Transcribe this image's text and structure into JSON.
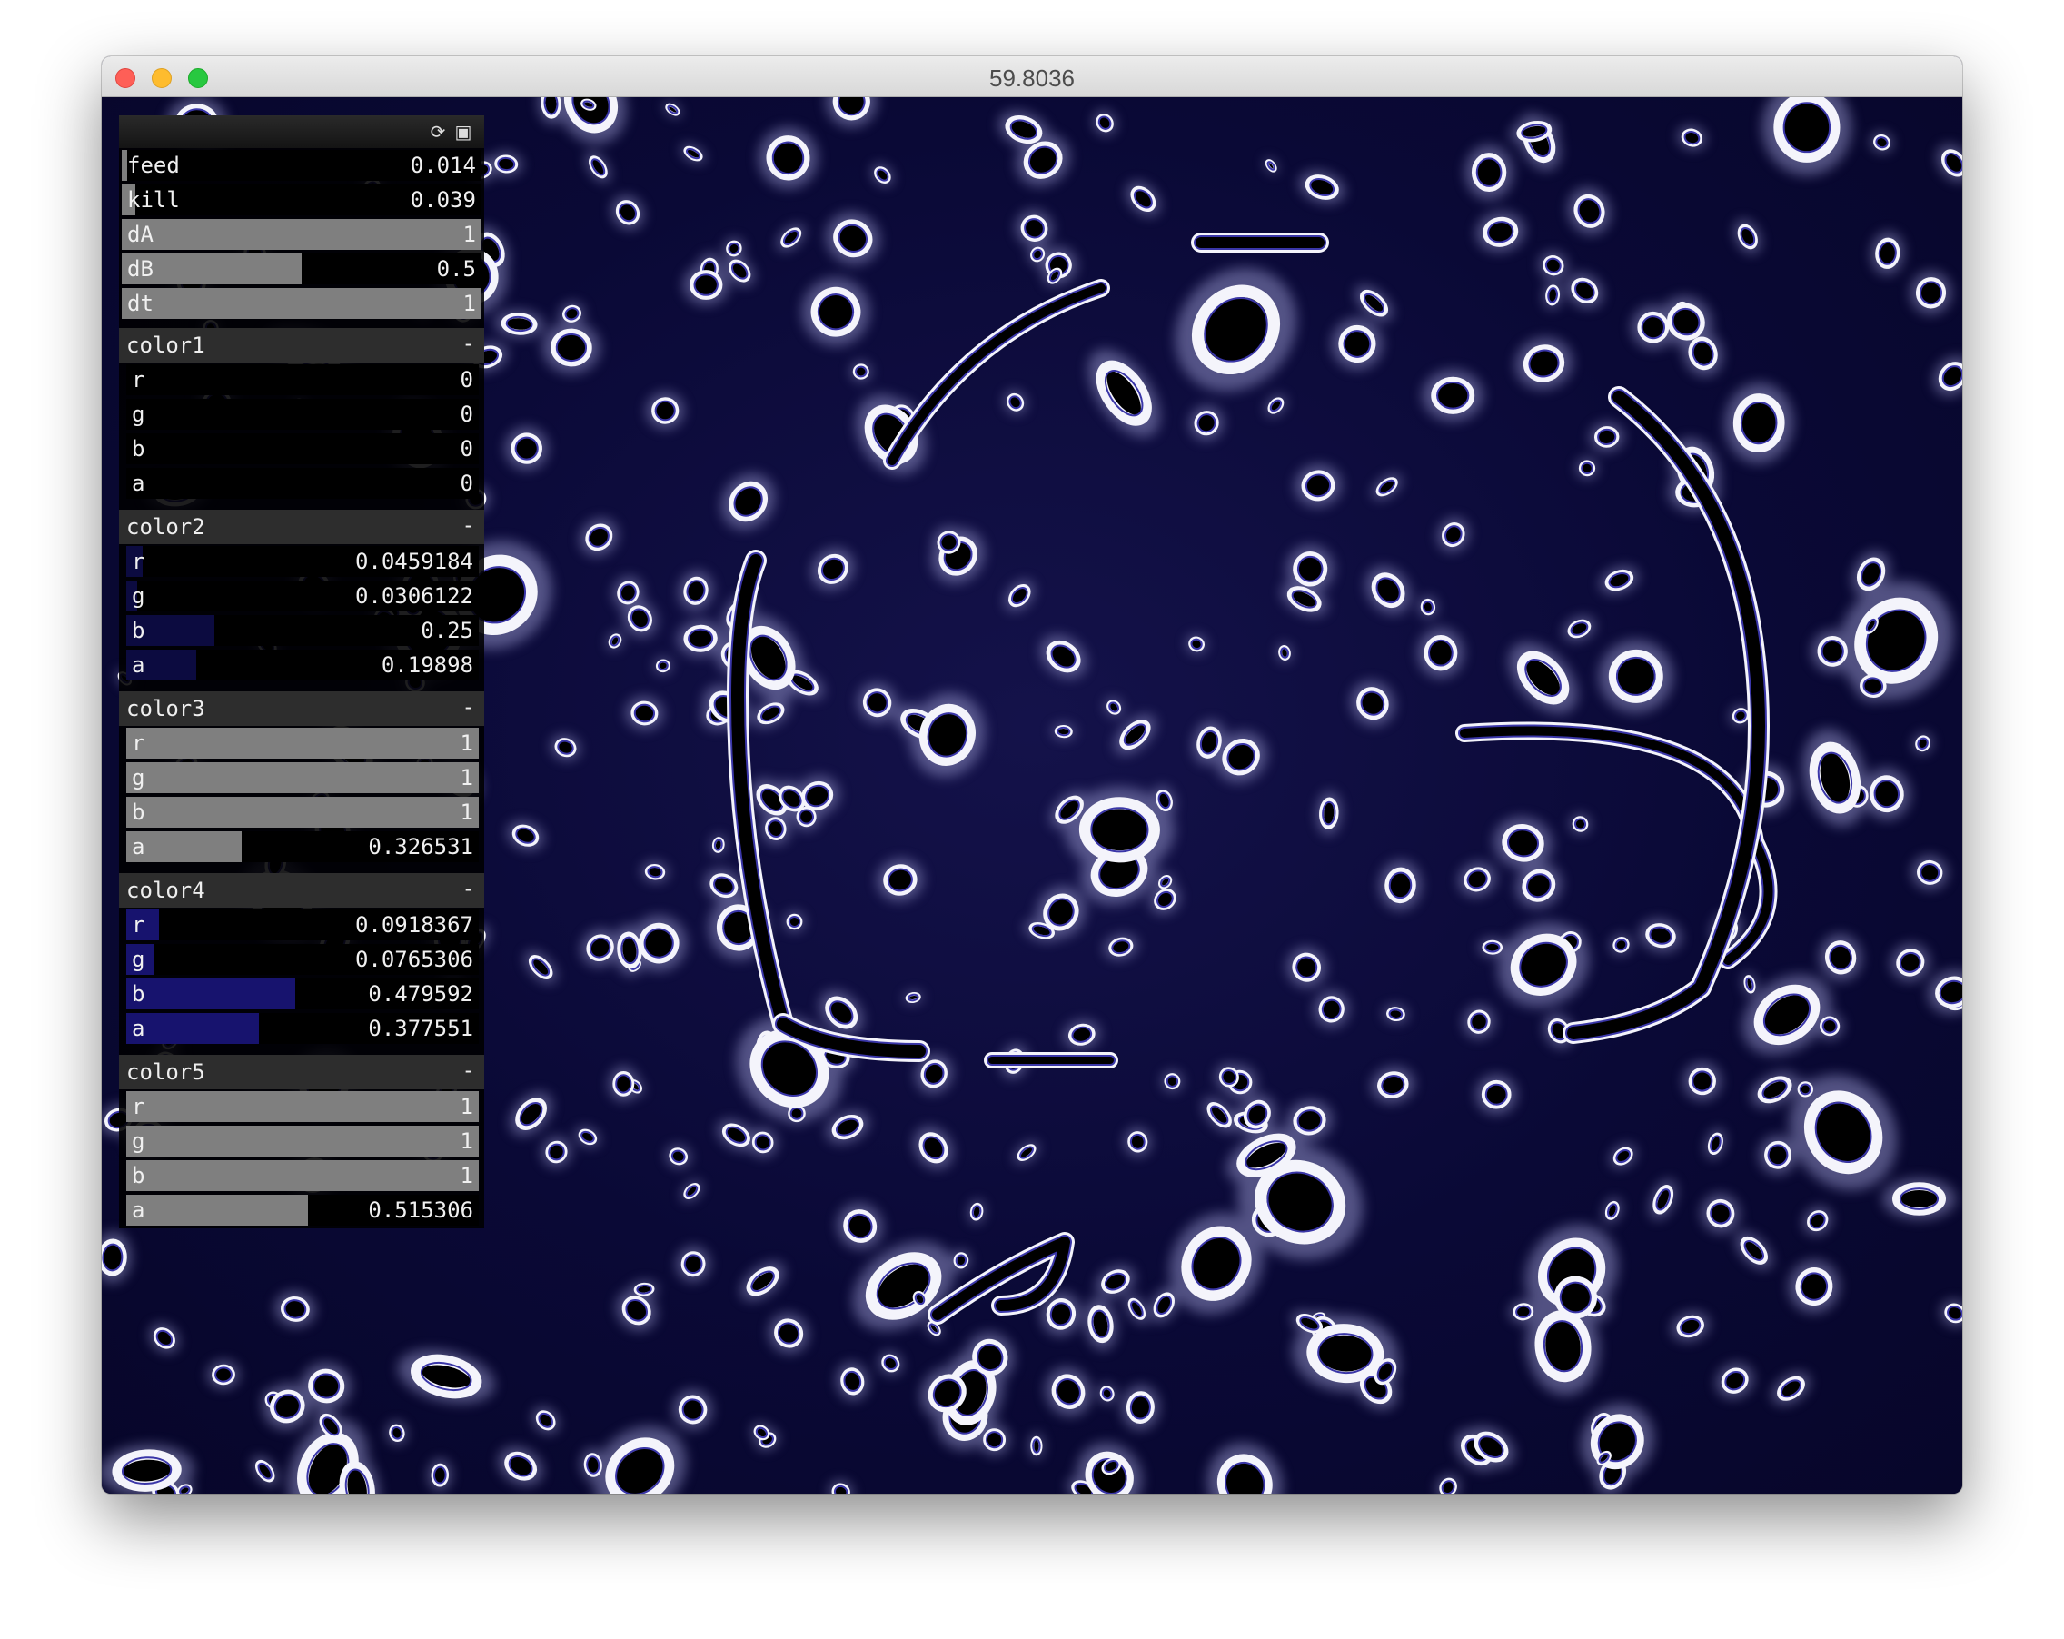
{
  "window": {
    "title": "59.8036"
  },
  "toolbar": {
    "reload_icon": "reload-icon",
    "save_icon": "save-icon"
  },
  "params": [
    {
      "label": "feed",
      "value": "0.014",
      "fraction": 0.014
    },
    {
      "label": "kill",
      "value": "0.039",
      "fraction": 0.039
    },
    {
      "label": "dA",
      "value": "1",
      "fraction": 1.0
    },
    {
      "label": "dB",
      "value": "0.5",
      "fraction": 0.5
    },
    {
      "label": "dt",
      "value": "1",
      "fraction": 1.0
    }
  ],
  "groups": [
    {
      "title": "color1",
      "collapse": "-",
      "channels": [
        {
          "label": "r",
          "value": "0",
          "fraction": 0
        },
        {
          "label": "g",
          "value": "0",
          "fraction": 0
        },
        {
          "label": "b",
          "value": "0",
          "fraction": 0
        },
        {
          "label": "a",
          "value": "0",
          "fraction": 0
        }
      ]
    },
    {
      "title": "color2",
      "collapse": "-",
      "channels": [
        {
          "label": "r",
          "value": "0.0459184",
          "fraction": 0.0459184
        },
        {
          "label": "g",
          "value": "0.0306122",
          "fraction": 0.0306122
        },
        {
          "label": "b",
          "value": "0.25",
          "fraction": 0.25
        },
        {
          "label": "a",
          "value": "0.19898",
          "fraction": 0.19898
        }
      ]
    },
    {
      "title": "color3",
      "collapse": "-",
      "channels": [
        {
          "label": "r",
          "value": "1",
          "fraction": 1
        },
        {
          "label": "g",
          "value": "1",
          "fraction": 1
        },
        {
          "label": "b",
          "value": "1",
          "fraction": 1
        },
        {
          "label": "a",
          "value": "0.326531",
          "fraction": 0.326531
        }
      ]
    },
    {
      "title": "color4",
      "collapse": "-",
      "channels": [
        {
          "label": "r",
          "value": "0.0918367",
          "fraction": 0.0918367
        },
        {
          "label": "g",
          "value": "0.0765306",
          "fraction": 0.0765306
        },
        {
          "label": "b",
          "value": "0.479592",
          "fraction": 0.479592
        },
        {
          "label": "a",
          "value": "0.377551",
          "fraction": 0.377551
        }
      ]
    },
    {
      "title": "color5",
      "collapse": "-",
      "channels": [
        {
          "label": "r",
          "value": "1",
          "fraction": 1
        },
        {
          "label": "g",
          "value": "1",
          "fraction": 1
        },
        {
          "label": "b",
          "value": "1",
          "fraction": 1
        },
        {
          "label": "a",
          "value": "0.515306",
          "fraction": 0.515306
        }
      ]
    }
  ],
  "colors": {
    "background": "#0c0b3a",
    "pattern_light": "#f4f4fb",
    "pattern_ring": "#3a36a8",
    "slider_fill": "#7f7f7f",
    "color2_fill": "#0c0b40",
    "color4_fill": "#17136e"
  }
}
